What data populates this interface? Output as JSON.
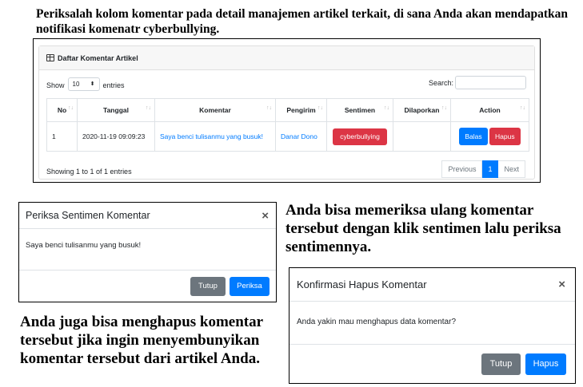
{
  "intro_text": "Periksalah kolom komentar pada detail manajemen artikel terkait, di sana Anda akan mendapatkan notifikasi komenatr cyberbullying.",
  "card": {
    "title": "Daftar Komentar Artikel",
    "show_label": "Show",
    "page_size": "10",
    "entries_label": "entries",
    "search_label": "Search:",
    "search_value": "",
    "columns": [
      "No",
      "Tanggal",
      "Komentar",
      "Pengirim",
      "Sentimen",
      "Dilaporkan",
      "Action"
    ],
    "rows": [
      {
        "no": "1",
        "tanggal": "2020-11-19 09:09:23",
        "komentar": "Saya benci tulisanmu yang busuk!",
        "pengirim": "Danar Dono",
        "sentimen": "cyberbullying",
        "dilaporkan": "",
        "action_reply": "Balas",
        "action_delete": "Hapus"
      }
    ],
    "info": "Showing 1 to 1 of 1 entries",
    "pagination": {
      "previous": "Previous",
      "current": "1",
      "next": "Next"
    }
  },
  "modal_sentimen": {
    "title": "Periksa Sentimen Komentar",
    "close": "×",
    "body": "Saya benci tulisanmu yang busuk!",
    "cancel": "Tutup",
    "confirm": "Periksa"
  },
  "note_periksa": "Anda bisa memeriksa ulang komentar tersebut dengan klik sentimen lalu periksa sentimennya.",
  "modal_hapus": {
    "title": "Konfirmasi Hapus Komentar",
    "close": "×",
    "body": "Anda yakin mau menghapus data komentar?",
    "cancel": "Tutup",
    "confirm": "Hapus"
  },
  "note_hapus": "Anda juga bisa menghapus komentar tersebut jika ingin menyembunyikan komentar tersebut dari artikel Anda.",
  "colors": {
    "primary": "#007bff",
    "danger": "#dc3545",
    "secondary": "#6c757d"
  }
}
